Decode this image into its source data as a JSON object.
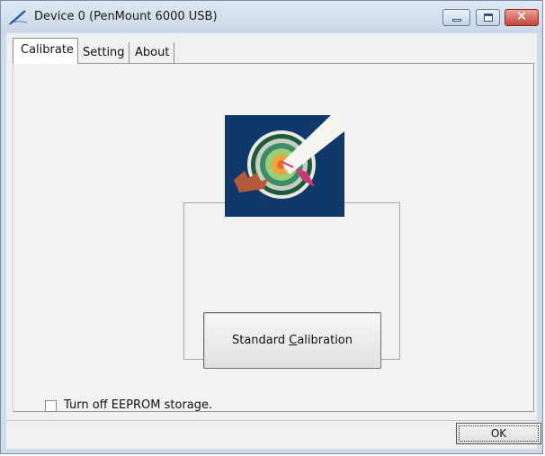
{
  "window": {
    "title": "Device 0 (PenMount 6000 USB)"
  },
  "tabs": [
    {
      "label": "Calibrate",
      "selected": true
    },
    {
      "label": "Setting",
      "selected": false
    },
    {
      "label": "About",
      "selected": false
    }
  ],
  "calibrate": {
    "standard_button_label_pre": "Standard ",
    "standard_button_label_key": "C",
    "standard_button_label_post": "alibration",
    "eeprom_checkbox_label": "Turn off EEPROM storage.",
    "eeprom_checked": false
  },
  "footer": {
    "ok_label": "OK"
  },
  "icons": {
    "title_icon": "pen-icon",
    "calibration_image": "target-pen-icon"
  },
  "colors": {
    "titlebar": "#cfdbe9",
    "close_button": "#c0453a",
    "image_background": "#11386b"
  }
}
